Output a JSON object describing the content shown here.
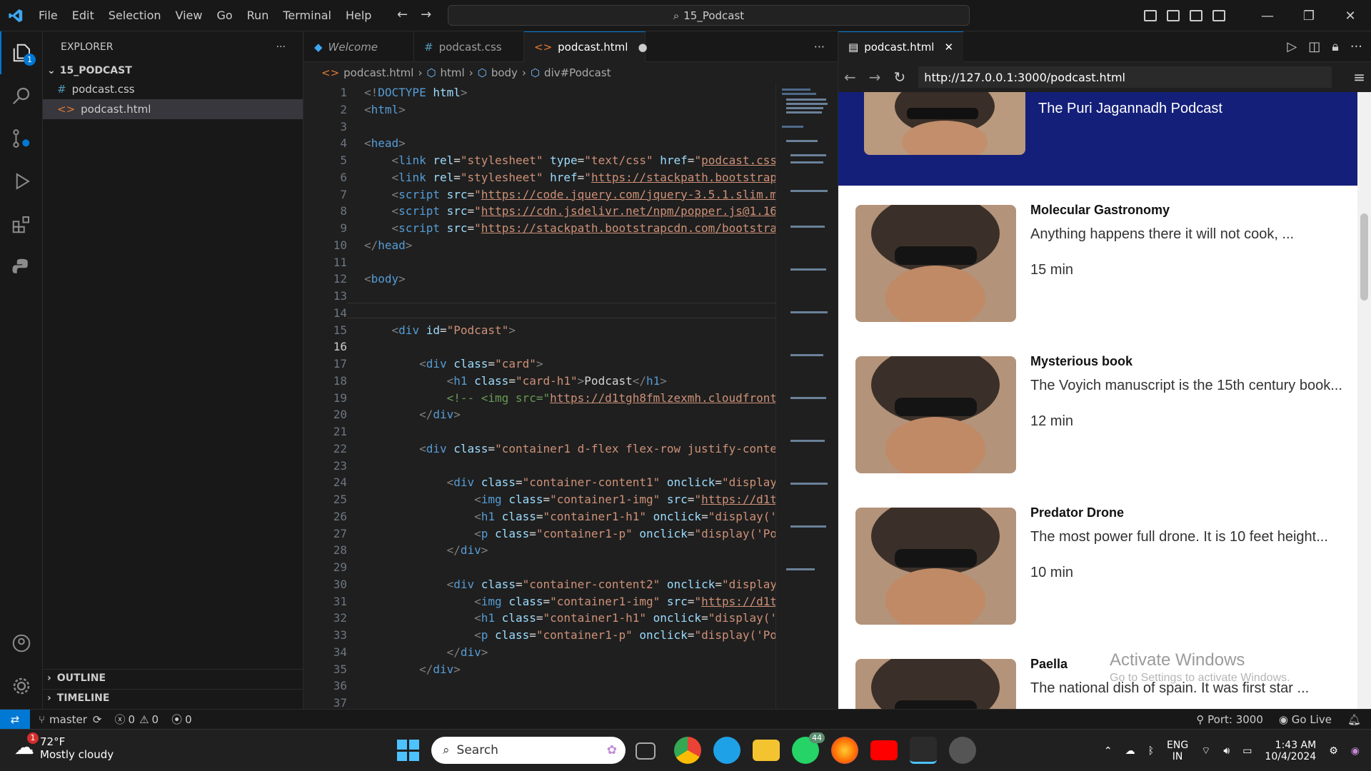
{
  "menu": [
    "File",
    "Edit",
    "Selection",
    "View",
    "Go",
    "Run",
    "Terminal",
    "Help"
  ],
  "command_center": "15_Podcast",
  "activity_badge": "1",
  "explorer": {
    "title": "EXPLORER",
    "folder": "15_PODCAST",
    "files": [
      "podcast.css",
      "podcast.html"
    ],
    "outline": "OUTLINE",
    "timeline": "TIMELINE"
  },
  "tabs": [
    "Welcome",
    "podcast.css",
    "podcast.html"
  ],
  "breadcrumb": [
    "podcast.html",
    "html",
    "body",
    "div#Podcast"
  ],
  "line_numbers": [
    "1",
    "2",
    "3",
    "4",
    "5",
    "6",
    "7",
    "8",
    "9",
    "10",
    "11",
    "12",
    "13",
    "14",
    "15",
    "16",
    "17",
    "18",
    "19",
    "20",
    "21",
    "22",
    "23",
    "24",
    "25",
    "26",
    "27",
    "28",
    "29",
    "30",
    "31",
    "32",
    "33",
    "34",
    "35",
    "36",
    "37"
  ],
  "preview": {
    "tab": "podcast.html",
    "url": "http://127.0.0.1:3000/podcast.html",
    "hero_title": "The Puri Jagannadh Podcast",
    "items": [
      {
        "title": "Molecular Gastronomy",
        "desc": "Anything happens there it will not cook, ...",
        "dur": "15 min"
      },
      {
        "title": "Mysterious book",
        "desc": "The Voyich manuscript is the 15th century book...",
        "dur": "12 min"
      },
      {
        "title": "Predator Drone",
        "desc": "The most power full drone. It is 10 feet height...",
        "dur": "10 min"
      },
      {
        "title": "Paella",
        "desc": "The national dish of spain. It was first star ...",
        "dur": ""
      }
    ],
    "watermark1": "Activate Windows",
    "watermark2": "Go to Settings to activate Windows."
  },
  "status": {
    "branch": "master",
    "errors": "0",
    "warnings": "0",
    "ports": "0",
    "port": "Port: 3000",
    "golive": "Go Live"
  },
  "taskbar": {
    "temp": "72°F",
    "weather": "Mostly cloudy",
    "weather_badge": "1",
    "search": "Search",
    "whatsapp_badge": "44",
    "lang1": "ENG",
    "lang2": "IN",
    "time": "1:43 AM",
    "date": "10/4/2024"
  },
  "colors": {
    "accent": "#0078d4",
    "hero": "#141f7a"
  }
}
